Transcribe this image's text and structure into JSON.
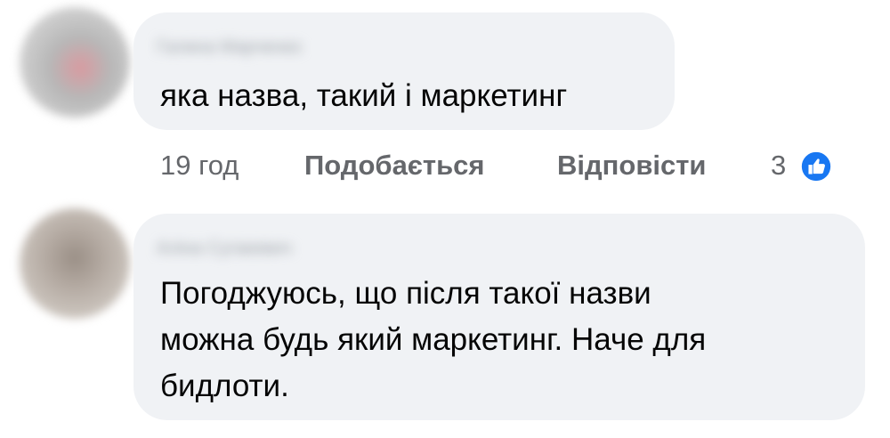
{
  "comments": [
    {
      "author": "Галина Марченко",
      "text": "яка назва, такий і маркетинг",
      "timestamp": "19 год",
      "like_label": "Подобається",
      "reply_label": "Відповісти",
      "reaction_count": "3",
      "reaction_color": "#1877f2"
    },
    {
      "author": "Аліна Сугакевич",
      "text": "Погоджуюсь, що після такої назви\nможна будь який маркетинг. Наче для\nбидлоти."
    }
  ],
  "colors": {
    "bubble_background": "#f0f2f5",
    "text_primary": "#050505",
    "text_secondary": "#65676b"
  }
}
